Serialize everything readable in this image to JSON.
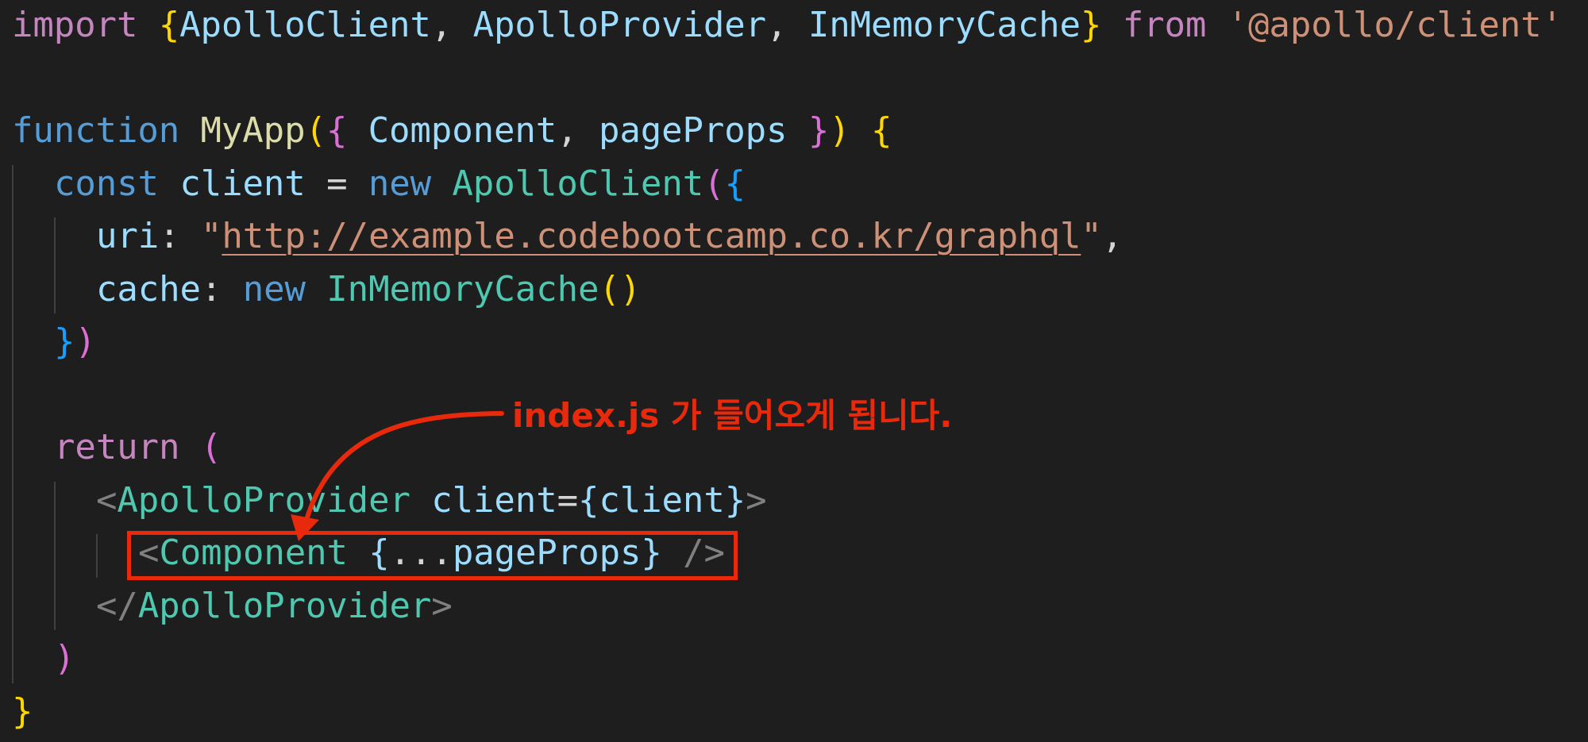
{
  "colors": {
    "background": "#1e1e1e",
    "keyword_control": "#c586c0",
    "keyword_storage": "#569cd6",
    "variable": "#9cdcfe",
    "type": "#4ec9b0",
    "function": "#dcdcaa",
    "string": "#ce9178",
    "punctuation": "#d4d4d4",
    "tag_bracket": "#808080",
    "bracket_gold": "#ffd700",
    "bracket_pink": "#da70d6",
    "bracket_blue": "#179fff",
    "annotation_red": "#e8290b"
  },
  "code_lines": [
    {
      "indent": 0,
      "tokens": [
        {
          "t": "import ",
          "c": "keyword_control"
        },
        {
          "t": "{",
          "c": "bracket_gold"
        },
        {
          "t": "ApolloClient",
          "c": "variable"
        },
        {
          "t": ", ",
          "c": "punctuation"
        },
        {
          "t": "ApolloProvider",
          "c": "variable"
        },
        {
          "t": ", ",
          "c": "punctuation"
        },
        {
          "t": "InMemoryCache",
          "c": "variable"
        },
        {
          "t": "}",
          "c": "bracket_gold"
        },
        {
          "t": " from ",
          "c": "keyword_control"
        },
        {
          "t": "'@apollo/client'",
          "c": "string"
        }
      ]
    },
    {
      "indent": 0,
      "tokens": []
    },
    {
      "indent": 0,
      "tokens": [
        {
          "t": "function ",
          "c": "keyword_storage"
        },
        {
          "t": "MyApp",
          "c": "function"
        },
        {
          "t": "(",
          "c": "bracket_gold"
        },
        {
          "t": "{",
          "c": "bracket_pink"
        },
        {
          "t": " Component",
          "c": "variable"
        },
        {
          "t": ", ",
          "c": "punctuation"
        },
        {
          "t": "pageProps ",
          "c": "variable"
        },
        {
          "t": "}",
          "c": "bracket_pink"
        },
        {
          "t": ")",
          "c": "bracket_gold"
        },
        {
          "t": " ",
          "c": "punctuation"
        },
        {
          "t": "{",
          "c": "bracket_gold"
        }
      ]
    },
    {
      "indent": 1,
      "tokens": [
        {
          "t": "const ",
          "c": "keyword_storage"
        },
        {
          "t": "client",
          "c": "variable"
        },
        {
          "t": " = ",
          "c": "punctuation"
        },
        {
          "t": "new ",
          "c": "keyword_storage"
        },
        {
          "t": "ApolloClient",
          "c": "type"
        },
        {
          "t": "(",
          "c": "bracket_pink"
        },
        {
          "t": "{",
          "c": "bracket_blue"
        }
      ]
    },
    {
      "indent": 2,
      "tokens": [
        {
          "t": "uri",
          "c": "variable"
        },
        {
          "t": ": ",
          "c": "punctuation"
        },
        {
          "t": "\"",
          "c": "string"
        },
        {
          "t": "http://example.codebootcamp.co.kr/graphql",
          "c": "string",
          "url": true
        },
        {
          "t": "\"",
          "c": "string"
        },
        {
          "t": ",",
          "c": "punctuation"
        }
      ]
    },
    {
      "indent": 2,
      "tokens": [
        {
          "t": "cache",
          "c": "variable"
        },
        {
          "t": ": ",
          "c": "punctuation"
        },
        {
          "t": "new ",
          "c": "keyword_storage"
        },
        {
          "t": "InMemoryCache",
          "c": "type"
        },
        {
          "t": "()",
          "c": "bracket_gold"
        }
      ]
    },
    {
      "indent": 1,
      "tokens": [
        {
          "t": "}",
          "c": "bracket_blue"
        },
        {
          "t": ")",
          "c": "bracket_pink"
        }
      ]
    },
    {
      "indent": 0,
      "tokens": []
    },
    {
      "indent": 1,
      "tokens": [
        {
          "t": "return ",
          "c": "keyword_control"
        },
        {
          "t": "(",
          "c": "bracket_pink"
        }
      ]
    },
    {
      "indent": 2,
      "tokens": [
        {
          "t": "<",
          "c": "tag_bracket"
        },
        {
          "t": "ApolloProvider",
          "c": "type"
        },
        {
          "t": " client",
          "c": "variable"
        },
        {
          "t": "=",
          "c": "punctuation"
        },
        {
          "t": "{",
          "c": "variable"
        },
        {
          "t": "client",
          "c": "variable"
        },
        {
          "t": "}",
          "c": "variable"
        },
        {
          "t": ">",
          "c": "tag_bracket"
        }
      ]
    },
    {
      "indent": 3,
      "tokens": [
        {
          "t": "<",
          "c": "tag_bracket"
        },
        {
          "t": "Component",
          "c": "type"
        },
        {
          "t": " ",
          "c": "punctuation"
        },
        {
          "t": "{",
          "c": "variable"
        },
        {
          "t": "...",
          "c": "punctuation"
        },
        {
          "t": "pageProps",
          "c": "variable"
        },
        {
          "t": "}",
          "c": "variable"
        },
        {
          "t": " />",
          "c": "tag_bracket"
        }
      ]
    },
    {
      "indent": 2,
      "tokens": [
        {
          "t": "</",
          "c": "tag_bracket"
        },
        {
          "t": "ApolloProvider",
          "c": "type"
        },
        {
          "t": ">",
          "c": "tag_bracket"
        }
      ]
    },
    {
      "indent": 1,
      "tokens": [
        {
          "t": ")",
          "c": "bracket_pink"
        }
      ]
    },
    {
      "indent": 0,
      "tokens": [
        {
          "t": "}",
          "c": "bracket_gold"
        }
      ]
    }
  ],
  "annotation": {
    "text": "index.js 가 들어오게 됩니다."
  }
}
